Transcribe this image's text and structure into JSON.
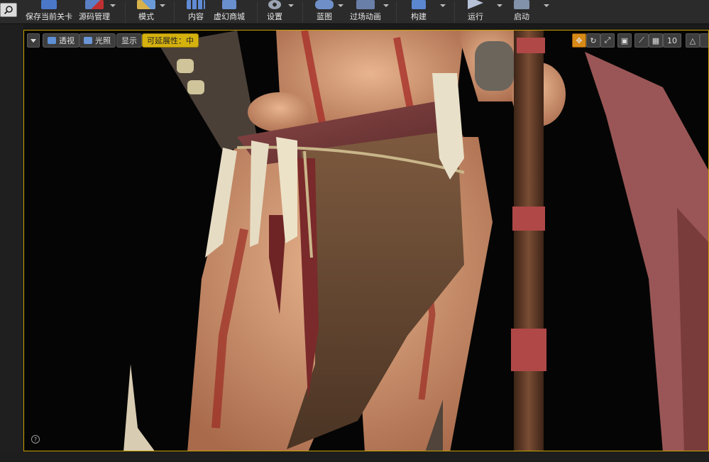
{
  "toolbar": {
    "buttons": [
      {
        "label": "保存当前关卡",
        "icon": "save-icon"
      },
      {
        "label": "源码管理",
        "icon": "source-control-icon"
      },
      {
        "label": "模式",
        "icon": "modes-icon"
      },
      {
        "label": "内容",
        "icon": "content-icon"
      },
      {
        "label": "虚幻商城",
        "icon": "marketplace-icon"
      },
      {
        "label": "设置",
        "icon": "settings-icon"
      },
      {
        "label": "蓝图",
        "icon": "blueprint-icon"
      },
      {
        "label": "过场动画",
        "icon": "cinematics-icon"
      },
      {
        "label": "构建",
        "icon": "build-icon"
      },
      {
        "label": "运行",
        "icon": "play-icon"
      },
      {
        "label": "启动",
        "icon": "launch-icon"
      }
    ]
  },
  "viewport": {
    "perspective_label": "透视",
    "lighting_label": "光照",
    "show_label": "显示",
    "scalability_label": "可延展性：中",
    "grid_snap_value": "10"
  },
  "colors": {
    "accent": "#d5b10e",
    "viewport_border": "#c9a000",
    "toolbar_bg": "#2b2b2b"
  }
}
